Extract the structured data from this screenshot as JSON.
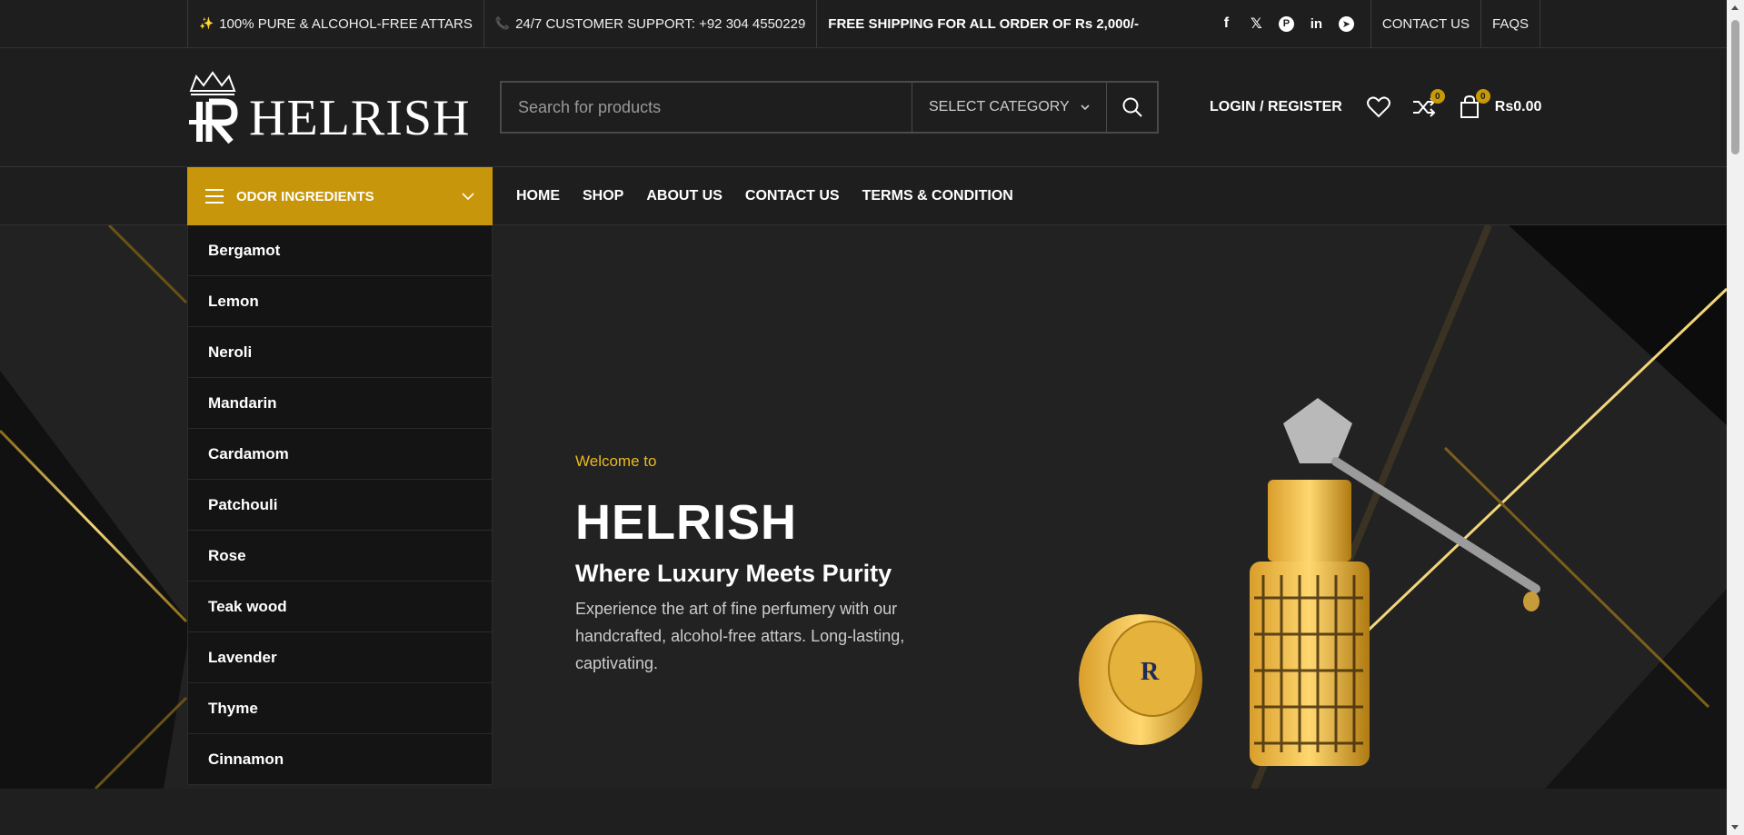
{
  "topbar": {
    "item1_icon": "sparkle-icon",
    "item1_text": "100% PURE & ALCOHOL-FREE ATTARS",
    "item2_icon": "phone-icon",
    "item2_text": "24/7 CUSTOMER SUPPORT: +92 304 4550229",
    "shipping": "FREE SHIPPING FOR ALL ORDER OF Rs 2,000/-",
    "social": [
      "facebook-icon",
      "x-icon",
      "pinterest-icon",
      "linkedin-icon",
      "telegram-icon"
    ],
    "contact": "CONTACT US",
    "faqs": "FAQS"
  },
  "header": {
    "logo_text": "HELRISH",
    "search_placeholder": "Search for products",
    "category_label": "SELECT CATEGORY",
    "login": "LOGIN / REGISTER",
    "compare_count": "0",
    "cart_count": "0",
    "cart_total": "Rs0.00"
  },
  "nav": {
    "odor_label": "ODOR INGREDIENTS",
    "links": [
      "HOME",
      "SHOP",
      "ABOUT US",
      "CONTACT US",
      "TERMS & CONDITION"
    ]
  },
  "categories": [
    "Bergamot",
    "Lemon",
    "Neroli",
    "Mandarin",
    "Cardamom",
    "Patchouli",
    "Rose",
    "Teak wood",
    "Lavender",
    "Thyme",
    "Cinnamon"
  ],
  "hero": {
    "welcome": "Welcome to",
    "brand": "HELRISH",
    "tagline": "Where Luxury Meets Purity",
    "description": "Experience the art of fine perfumery with our handcrafted, alcohol-free attars. Long-lasting, captivating."
  },
  "colors": {
    "accent": "#c7960a",
    "welcome": "#e8b923",
    "background": "#1e1e1e"
  }
}
